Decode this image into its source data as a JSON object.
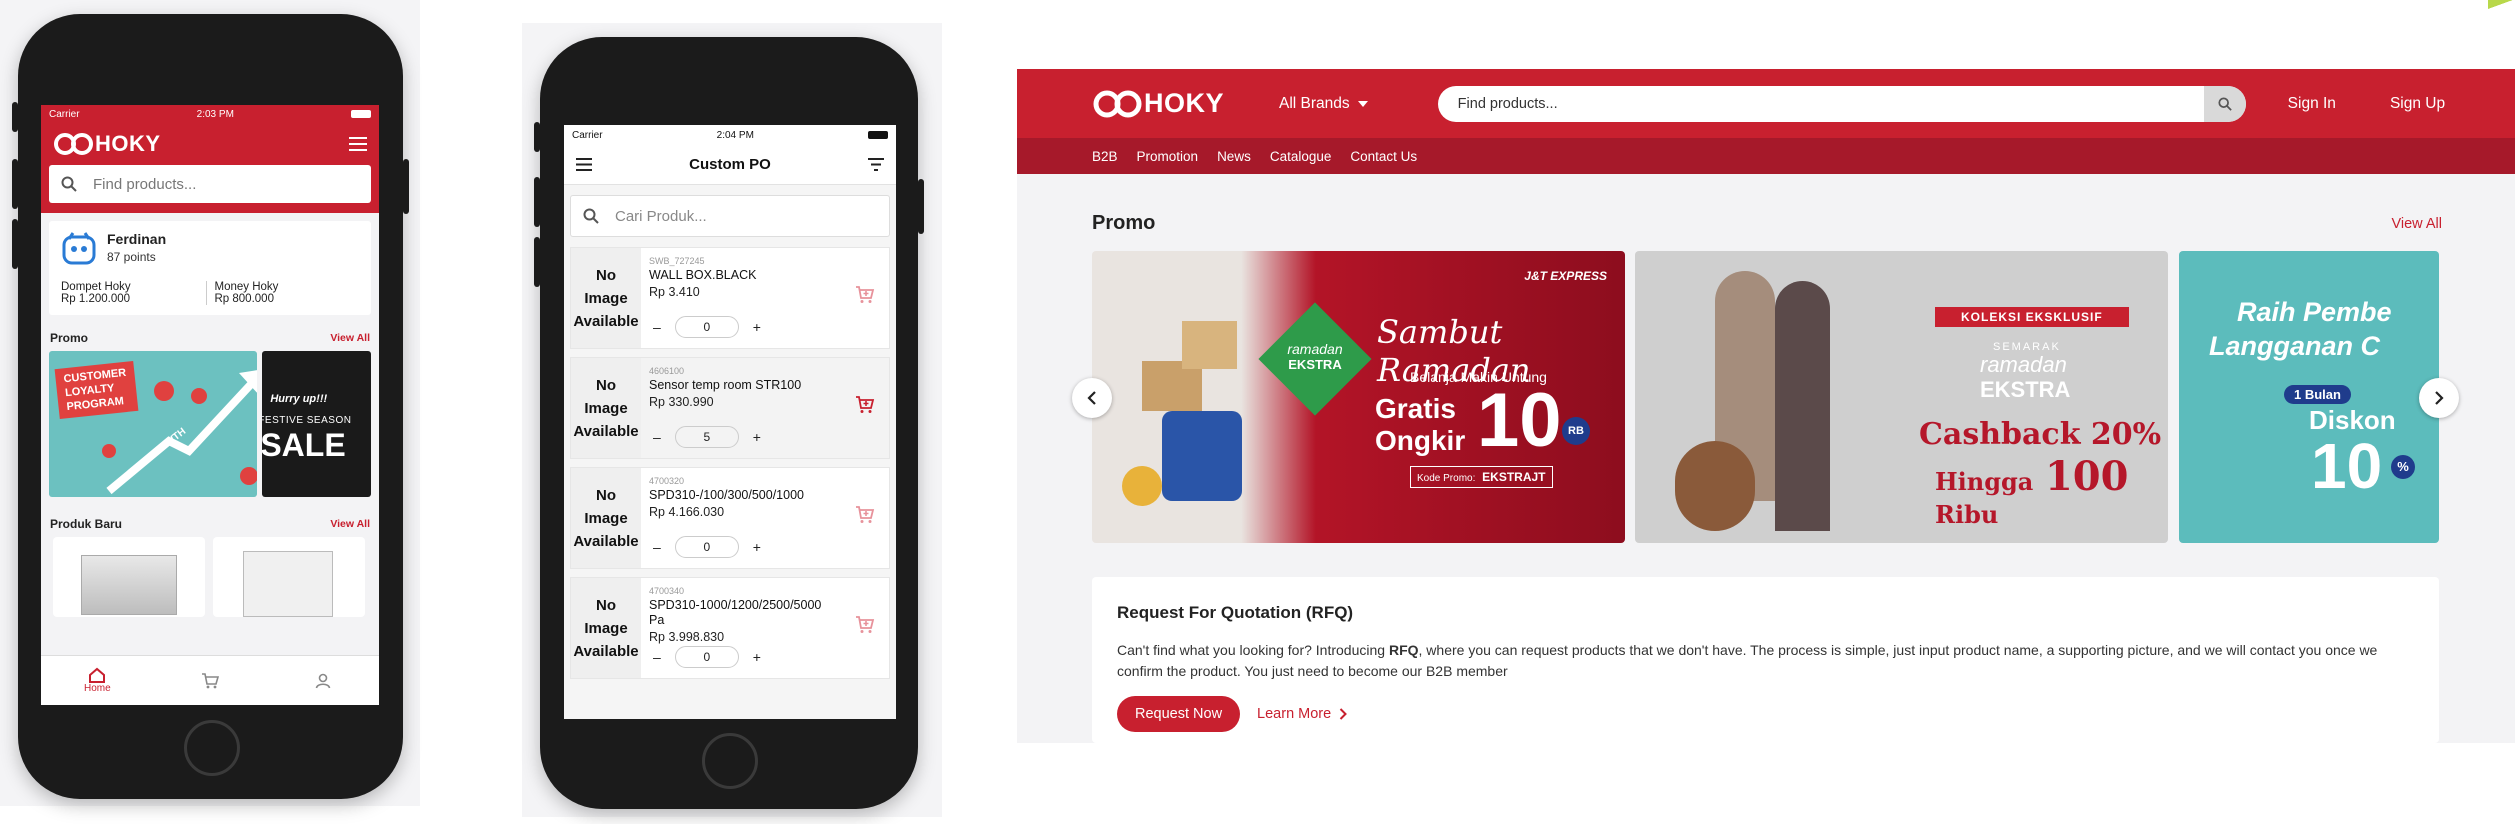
{
  "phone1": {
    "status": {
      "carrier": "Carrier",
      "time": "2:03 PM"
    },
    "logo_text": "HOKY",
    "search": {
      "placeholder": "Find products..."
    },
    "user": {
      "name": "Ferdinan",
      "points": "87 points"
    },
    "wallets": [
      {
        "label": "Dompet Hoky",
        "value": "Rp 1.200.000"
      },
      {
        "label": "Money Hoky",
        "value": "Rp 800.000"
      }
    ],
    "promo": {
      "title": "Promo",
      "view_all": "View All",
      "banner1_lines": [
        "CUSTOMER",
        "LOYALTY",
        "PROGRAM"
      ],
      "banner1_tag": "GROWTH",
      "banner2_top": "Hurry up!!!",
      "banner2_mid": "FESTIVE SEASON",
      "banner2_big": "SALE"
    },
    "new_products": {
      "title": "Produk Baru",
      "view_all": "View All"
    },
    "tabs": [
      {
        "label": "Home",
        "icon": "home-icon"
      },
      {
        "label": "",
        "icon": "cart-icon"
      },
      {
        "label": "",
        "icon": "user-icon"
      }
    ]
  },
  "phone2": {
    "status": {
      "carrier": "Carrier",
      "time": "2:04 PM"
    },
    "title": "Custom PO",
    "search": {
      "placeholder": "Cari Produk..."
    },
    "no_image_lines": [
      "No",
      "Image",
      "Available"
    ],
    "items": [
      {
        "sku": "SWB_727245",
        "name": "WALL BOX.BLACK",
        "price": "Rp 3.410",
        "qty": "0"
      },
      {
        "sku": "4606100",
        "name": "Sensor temp room STR100",
        "price": "Rp 330.990",
        "qty": "5"
      },
      {
        "sku": "4700320",
        "name": "SPD310-/100/300/500/1000",
        "price": "Rp 4.166.030",
        "qty": "0"
      },
      {
        "sku": "4700340",
        "name": "SPD310-1000/1200/2500/5000 Pa",
        "price": "Rp 3.998.830",
        "qty": "0"
      }
    ],
    "minus": "–",
    "plus": "+"
  },
  "web": {
    "logo_text": "HOKY",
    "brands_label": "All Brands",
    "search": {
      "placeholder": "Find products..."
    },
    "sign_in": "Sign In",
    "sign_up": "Sign Up",
    "nav": [
      "B2B",
      "Promotion",
      "News",
      "Catalogue",
      "Contact Us"
    ],
    "promo_title": "Promo",
    "view_all": "View All",
    "banner1": {
      "brand": "J&T EXPRESS",
      "title": "Sambut Ramadan",
      "subtitle": "Belanja Makin Untung",
      "gratis": "Gratis",
      "ongkir": "Ongkir",
      "big": "10",
      "rb": "RB",
      "badge_top": "ramadan",
      "badge_bottom": "EKSTRA",
      "code_label": "Kode Promo:",
      "code": "EKSTRAJT"
    },
    "banner2": {
      "pill": "KOLEKSI EKSKLUSIF",
      "semarak": "SEMARAK",
      "ramadan": "ramadan",
      "ekstra": "EKSTRA",
      "cashback": "Cashback 20%",
      "hingga": "Hingga",
      "amount": "100",
      "ribu": "Ribu"
    },
    "banner3": {
      "line1": "Raih Pembe",
      "line2": "Langganan C",
      "pill": "1 Bulan",
      "diskon": "Diskon",
      "big": "10",
      "pct": "%"
    },
    "rfq": {
      "title": "Request For Quotation (RFQ)",
      "text_before": "Can't find what you looking for? Introducing ",
      "text_bold": "RFQ",
      "text_after": ", where you can request products that we don't have. The process is simple, just input product name, a supporting picture, and we will contact you once we confirm the product. You just need to become our B2B member",
      "request_button": "Request Now",
      "learn_more": "Learn More"
    }
  }
}
